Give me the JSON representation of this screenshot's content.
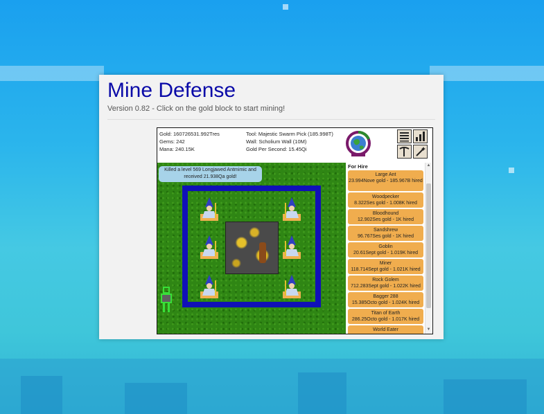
{
  "app": {
    "title": "Mine Defense",
    "subtitle": "Version 0.82 - Click on the gold block to start mining!"
  },
  "stats": {
    "gold": "Gold: 160726531.992Tres",
    "gems": "Gems: 242",
    "mana": "Mana: 240.15K",
    "tool": "Tool: Majestic Swarm Pick (185.998T)",
    "wall": "Wall: Scholium Wall (10M)",
    "gps": "Gold Per Second: 15.45Qi"
  },
  "notice": "Killed a level 569 Longjawed Antmimic and received 21.938Qa gold!",
  "hire": {
    "title": "For Hire",
    "items": [
      {
        "name": "Large Ant",
        "detail": "23.994Nove gold - 185.967B hired"
      },
      {
        "name": "Woodpecker",
        "detail": "8.322Ses gold - 1.008K hired"
      },
      {
        "name": "Bloodhound",
        "detail": "12.902Ses gold - 1K hired"
      },
      {
        "name": "Sandshrew",
        "detail": "96.767Ses gold - 1K hired"
      },
      {
        "name": "Goblin",
        "detail": "20.61Sept gold - 1.019K hired"
      },
      {
        "name": "Miner",
        "detail": "118.714Sept gold - 1.021K hired"
      },
      {
        "name": "Rock Golem",
        "detail": "712.283Sept gold - 1.022K hired"
      },
      {
        "name": "Bagger 288",
        "detail": "15.385Octo gold - 1.024K hired"
      },
      {
        "name": "Titan of Earth",
        "detail": "286.25Octo gold - 1.017K hired"
      },
      {
        "name": "World Eater",
        "detail": ""
      }
    ]
  },
  "colors": {
    "title": "#0a0aa8",
    "wall": "#1010b8",
    "hire_button": "#f0ad4e",
    "notice_bg": "#a7d3e9"
  },
  "icons": [
    "orb-icon",
    "list-menu-icon",
    "stats-chart-icon",
    "pickaxe-icon",
    "magic-wand-icon",
    "wizard-icon",
    "golem-icon"
  ]
}
